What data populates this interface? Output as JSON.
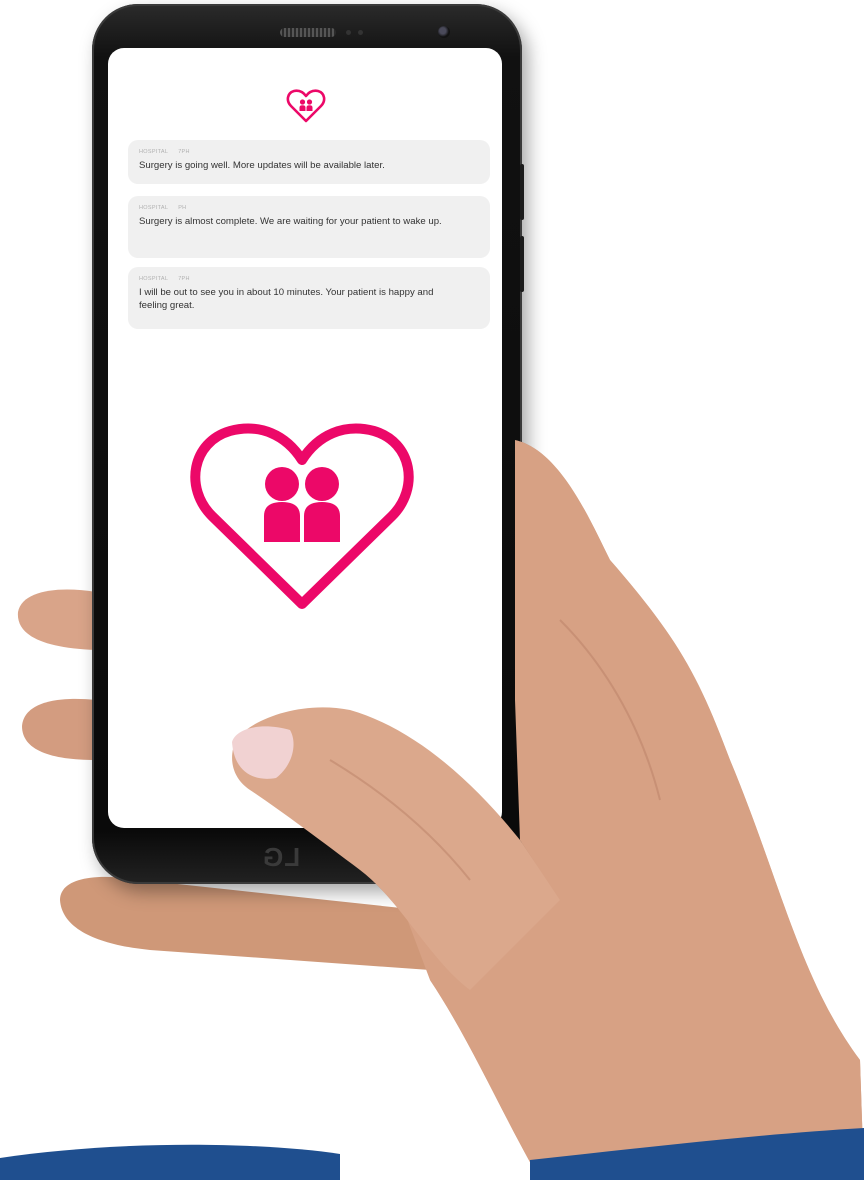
{
  "app": {
    "logo_icon": "heart-people-icon",
    "accent_color": "#ec0868"
  },
  "device": {
    "brand_logo": "LG"
  },
  "messages": [
    {
      "sender": "HOSPITAL",
      "time": "7PH",
      "text": "Surgery is going well. More updates will be available later."
    },
    {
      "sender": "HOSPITAL",
      "time": "PH",
      "text": "Surgery is almost complete. We are waiting for your patient to wake up."
    },
    {
      "sender": "HOSPITAL",
      "time": "7PH",
      "text": "I will be out to see you in about 10 minutes. Your patient is happy and feeling great."
    }
  ],
  "hero": {
    "icon": "heart-people-icon"
  },
  "colors": {
    "bubble_bg": "#f0f0f0",
    "bottom_band": "#1f4f8f"
  }
}
